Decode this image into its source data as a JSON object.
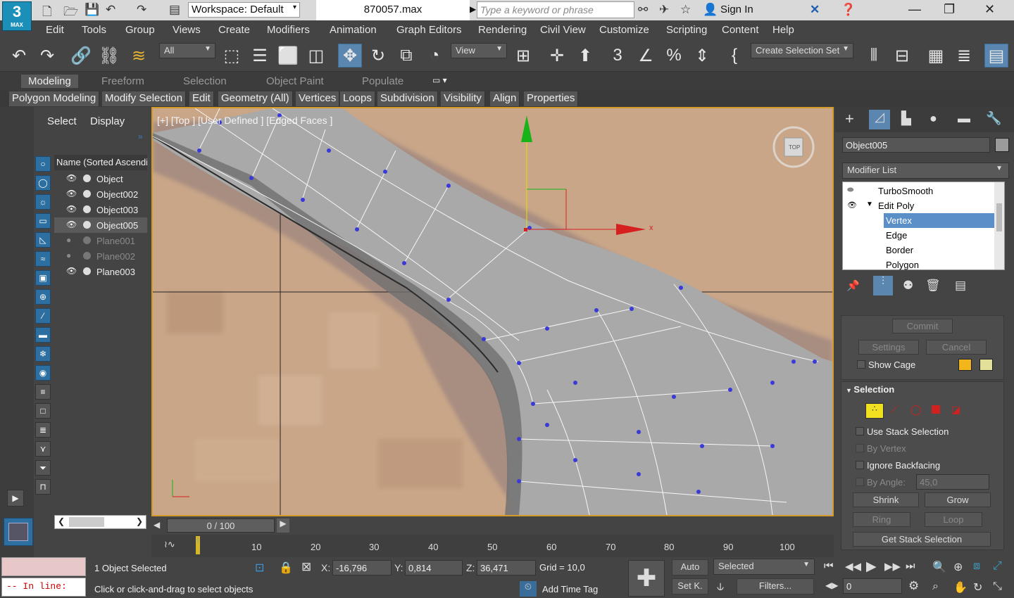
{
  "app": {
    "logo_main": "3",
    "logo_sub": "MAX",
    "title": "870057.max",
    "workspace": "Workspace: Default",
    "search_placeholder": "Type a keyword or phrase",
    "sign_in": "Sign In"
  },
  "menu": [
    "Edit",
    "Tools",
    "Group",
    "Views",
    "Create",
    "Modifiers",
    "Animation",
    "Graph Editors",
    "Rendering",
    "Civil View",
    "Customize",
    "Scripting",
    "Content",
    "Help"
  ],
  "toolbar": {
    "filter_value": "All",
    "view_value": "View",
    "selection_set": "Create Selection Set"
  },
  "ribbon_tabs": [
    "Modeling",
    "Freeform",
    "Selection",
    "Object Paint",
    "Populate"
  ],
  "ribbon_buttons": [
    "Polygon Modeling",
    "Modify Selection",
    "Edit",
    "Geometry (All)",
    "Vertices",
    "Loops",
    "Subdivision",
    "Visibility",
    "Align",
    "Properties"
  ],
  "scene": {
    "tab_select": "Select",
    "tab_display": "Display",
    "column_header": "Name (Sorted Ascending)",
    "objects": [
      {
        "name": "Object",
        "visible": true,
        "selected": false
      },
      {
        "name": "Object002",
        "visible": true,
        "selected": false
      },
      {
        "name": "Object003",
        "visible": true,
        "selected": false
      },
      {
        "name": "Object005",
        "visible": true,
        "selected": true
      },
      {
        "name": "Plane001",
        "visible": false,
        "selected": false
      },
      {
        "name": "Plane002",
        "visible": false,
        "selected": false
      },
      {
        "name": "Plane003",
        "visible": true,
        "selected": false
      }
    ]
  },
  "viewport": {
    "label": "[+] [Top ] [User Defined ] [Edged Faces ]",
    "viewcube_label": "TOP",
    "gizmo_x": "x"
  },
  "timeline": {
    "frame": "0 / 100",
    "ticks": [
      "10",
      "20",
      "30",
      "40",
      "50",
      "60",
      "70",
      "80",
      "90",
      "100"
    ]
  },
  "status": {
    "maxscript_prefix": "-- In line:",
    "objects_selected": "1 Object Selected",
    "prompt": "Click or click-and-drag to select objects",
    "x_label": "X:",
    "x": "-16,796",
    "y_label": "Y:",
    "y": "0,814",
    "z_label": "Z:",
    "z": "36,471",
    "grid": "Grid = 10,0",
    "add_time_tag": "Add Time Tag",
    "auto_key": "Auto",
    "set_key": "Set K.",
    "key_mode": "Selected",
    "filters": "Filters...",
    "current_frame": "0"
  },
  "command_panel": {
    "object_name": "Object005",
    "object_color": "#9a9a9a",
    "modifier_list": "Modifier List",
    "stack": [
      {
        "label": "TurboSmooth",
        "level": 0
      },
      {
        "label": "Edit Poly",
        "level": 0
      },
      {
        "label": "Vertex",
        "level": 1,
        "selected": true
      },
      {
        "label": "Edge",
        "level": 1
      },
      {
        "label": "Border",
        "level": 1
      },
      {
        "label": "Polygon",
        "level": 1
      }
    ],
    "commit": "Commit",
    "settings": "Settings",
    "cancel": "Cancel",
    "show_cage": "Show Cage",
    "cage_color_1": "#f2b51c",
    "cage_color_2": "#e3e09a",
    "selection_title": "Selection",
    "use_stack_selection": "Use Stack Selection",
    "by_vertex": "By Vertex",
    "ignore_backfacing": "Ignore Backfacing",
    "by_angle": "By Angle:",
    "angle_value": "45,0",
    "shrink": "Shrink",
    "grow": "Grow",
    "ring": "Ring",
    "loop": "Loop",
    "get_stack_selection": "Get Stack Selection"
  }
}
